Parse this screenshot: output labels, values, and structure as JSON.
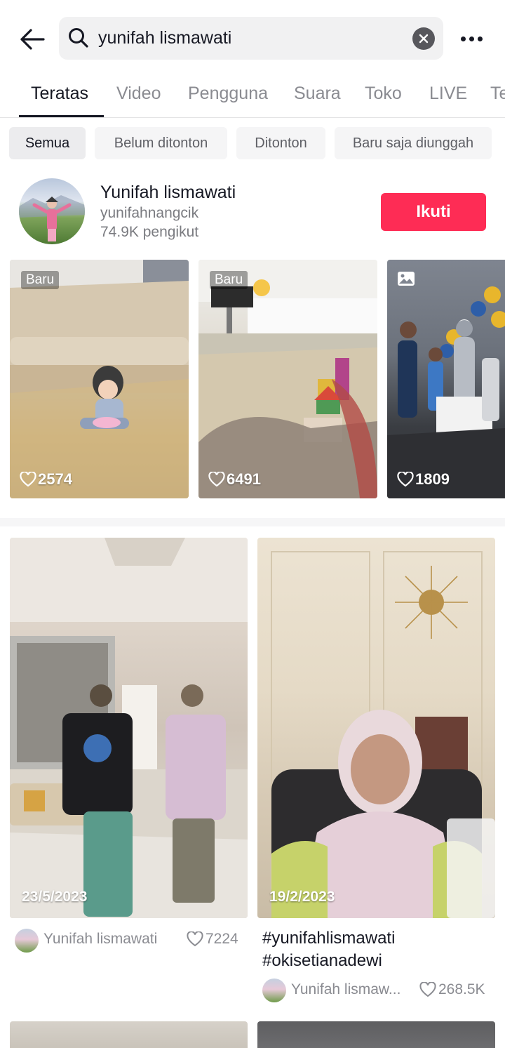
{
  "search": {
    "query": "yunifah lismawati"
  },
  "tabs": [
    {
      "label": "Teratas"
    },
    {
      "label": "Video"
    },
    {
      "label": "Pengguna"
    },
    {
      "label": "Suara"
    },
    {
      "label": "Toko"
    },
    {
      "label": "LIVE"
    },
    {
      "label": "Te"
    }
  ],
  "filters": [
    {
      "label": "Semua"
    },
    {
      "label": "Belum ditonton"
    },
    {
      "label": "Ditonton"
    },
    {
      "label": "Baru saja diunggah"
    }
  ],
  "user": {
    "name": "Yunifah lismawati",
    "handle": "yunifahnangcik",
    "followers": "74.9K pengikut",
    "follow_label": "Ikuti"
  },
  "user_videos": [
    {
      "badge": "Baru",
      "likes": "2574"
    },
    {
      "badge": "Baru",
      "likes": "6491"
    },
    {
      "likes": "1809"
    }
  ],
  "videos": [
    {
      "date": "23/5/2023",
      "caption": "",
      "author": "Yunifah lismawati",
      "likes": "7224"
    },
    {
      "date": "19/2/2023",
      "caption_line1": "#yunifahlismawati",
      "caption_line2": "#okisetianadewi",
      "author": "Yunifah lismaw...",
      "likes": "268.5K"
    }
  ],
  "colors": {
    "accent": "#fe2c55",
    "text": "#161823",
    "muted": "#8a8b91"
  }
}
